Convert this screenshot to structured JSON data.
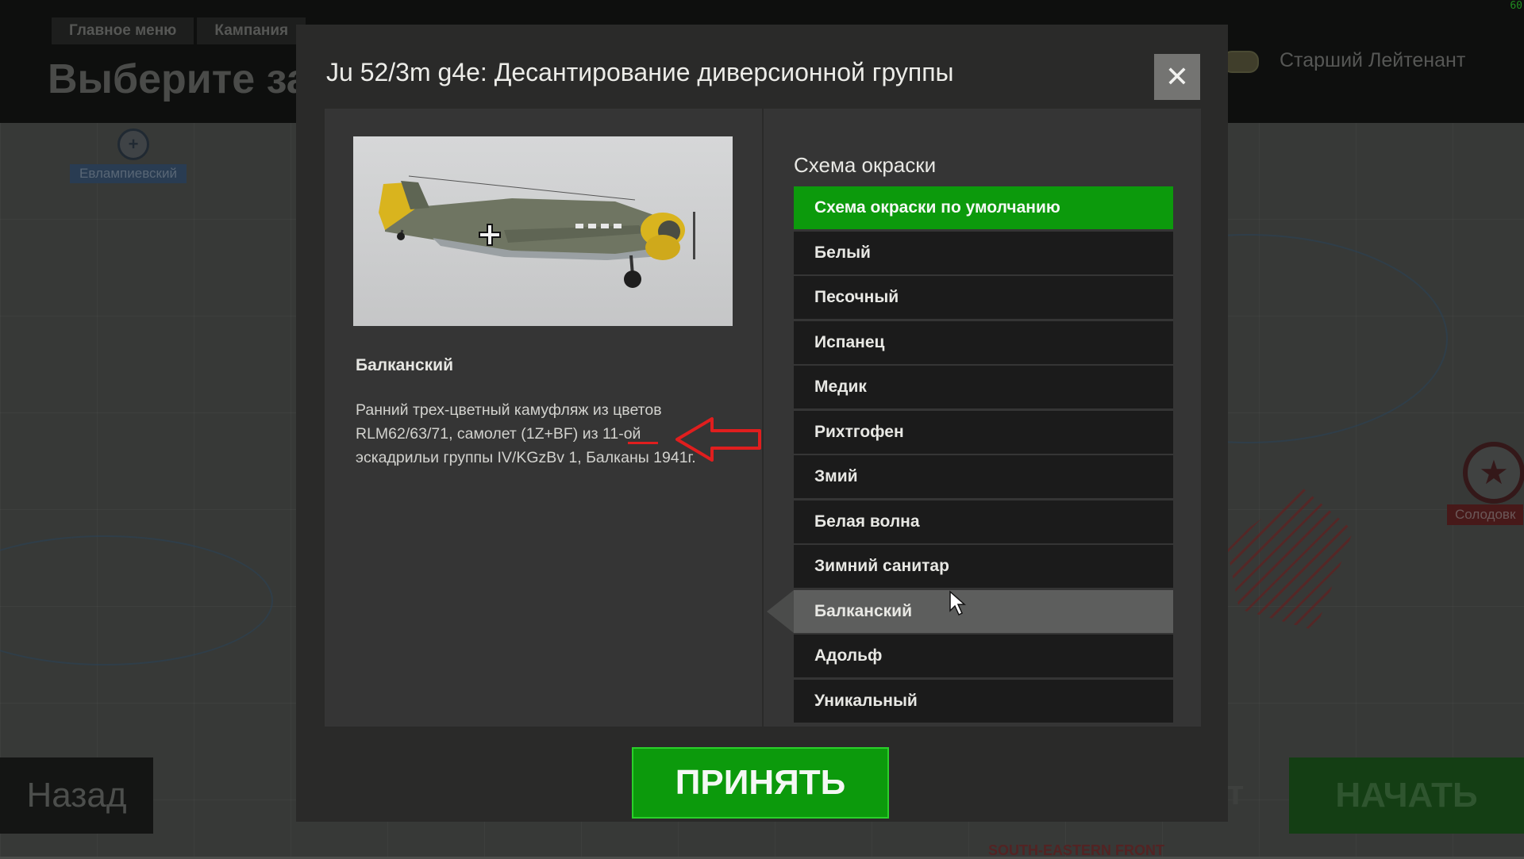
{
  "background": {
    "breadcrumb": [
      "Главное меню",
      "Кампания"
    ],
    "title": "Выберите за",
    "rank": "Старший Лейтенант",
    "fps": "60",
    "map_labels": {
      "evlampievskiy": "Евлампиевский",
      "solodovka": "Солодовк"
    },
    "front_label": "SOUTH-EASTERN FRONT",
    "back_button": "Назад",
    "start_button": "НАЧАТЬ",
    "partial_button_text": "от"
  },
  "modal": {
    "title": "Ju 52/3m g4e: Десантирование диверсионной группы",
    "close_icon": "close-icon",
    "selected_skin": {
      "name": "Балканский",
      "description_lines": [
        "Ранний трех-цветный камуфляж из цветов",
        "RLM62/63/71, самолет (1Z+BF) из 11-ой",
        "эскадрильи группы IV/KGzBv 1, Балканы 1941г."
      ]
    },
    "list_heading": "Схема окраски",
    "schemes": [
      "Схема окраски по умолчанию",
      "Белый",
      "Песочный",
      "Испанец",
      "Медик",
      "Рихтгофен",
      "Змий",
      "Белая волна",
      "Зимний санитар",
      "Балканский",
      "Адольф",
      "Уникальный"
    ],
    "default_scheme_index": 0,
    "selected_scheme_index": 9,
    "accept_button": "ПРИНЯТЬ"
  },
  "colors": {
    "accent_green": "#0c9a0c",
    "annotation_red": "#e01e1e",
    "list_item_bg": "#1b1b1b",
    "selected_item_bg": "#5d5e5d"
  }
}
